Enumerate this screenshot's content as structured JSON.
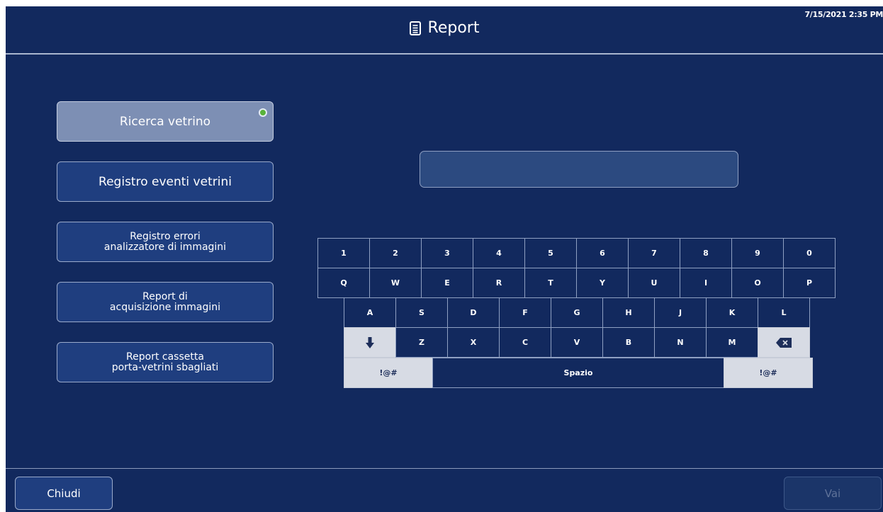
{
  "header": {
    "timestamp": "7/15/2021 2:35 PM",
    "title": "Report",
    "title_icon": "document-icon"
  },
  "menu": {
    "items": [
      {
        "label": "Ricerca vetrino",
        "active": true
      },
      {
        "label": "Registro eventi vetrini"
      },
      {
        "line1": "Registro errori",
        "line2": "analizzatore di immagini"
      },
      {
        "line1": "Report di",
        "line2": "acquisizione immagini"
      },
      {
        "line1": "Report cassetta",
        "line2": "porta-vetrini sbagliati"
      }
    ],
    "status_color": "#59b33a"
  },
  "search": {
    "value": "",
    "placeholder": ""
  },
  "keyboard": {
    "row1": [
      "1",
      "2",
      "3",
      "4",
      "5",
      "6",
      "7",
      "8",
      "9",
      "0"
    ],
    "row2": [
      "Q",
      "W",
      "E",
      "R",
      "T",
      "Y",
      "U",
      "I",
      "O",
      "P"
    ],
    "row3": [
      "A",
      "S",
      "D",
      "F",
      "G",
      "H",
      "J",
      "K",
      "L"
    ],
    "row4": [
      "Z",
      "X",
      "C",
      "V",
      "B",
      "N",
      "M"
    ],
    "symbols_left": "!@#",
    "space": "Spazio",
    "symbols_right": "!@#",
    "shift_icon": "arrow-down-icon",
    "backspace_icon": "backspace-icon"
  },
  "footer": {
    "close_label": "Chiudi",
    "go_label": "Vai"
  },
  "colors": {
    "background": "#12295e",
    "button": "#1f3e7f",
    "active_button": "#7d8fb4"
  }
}
